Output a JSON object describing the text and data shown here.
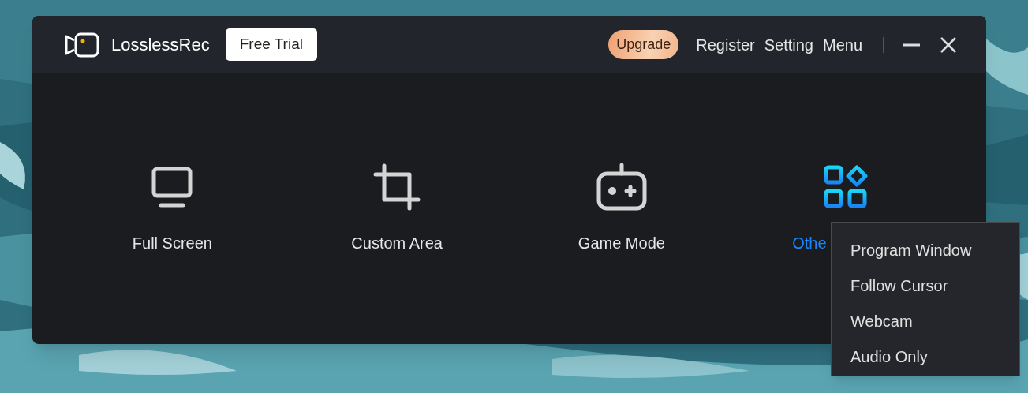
{
  "app": {
    "name": "LosslessRec",
    "badge": "Free Trial"
  },
  "header_actions": [
    {
      "kind": "upgrade",
      "label": "Upgrade"
    },
    {
      "kind": "link",
      "label": "Register"
    },
    {
      "kind": "link",
      "label": "Setting"
    },
    {
      "kind": "link",
      "label": "Menu"
    }
  ],
  "modes": [
    {
      "kind": "monitor",
      "label": "Full Screen",
      "selected": false
    },
    {
      "kind": "crop",
      "label": "Custom Area",
      "selected": false
    },
    {
      "kind": "gamepad",
      "label": "Game Mode",
      "selected": false
    },
    {
      "kind": "apps",
      "label": "Othe",
      "selected": true
    }
  ],
  "dropdown": [
    "Program Window",
    "Follow Cursor",
    "Webcam",
    "Audio Only"
  ]
}
